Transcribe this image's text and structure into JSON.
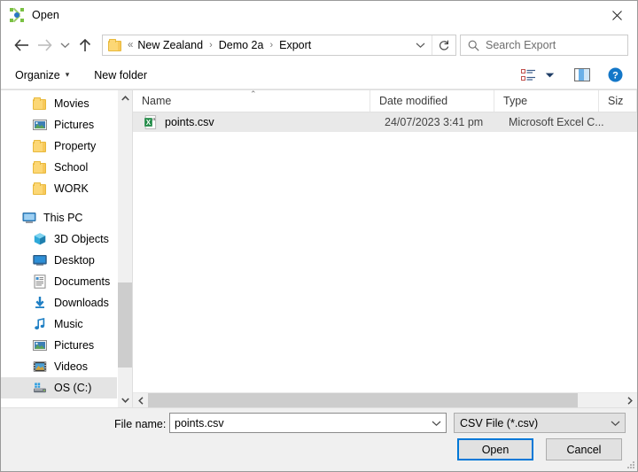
{
  "window": {
    "title": "Open",
    "app_icon": "molecule-icon",
    "close_label": "Close"
  },
  "navbar": {
    "back_icon": "back-arrow-icon",
    "forward_icon": "forward-arrow-icon",
    "recent_icon": "recent-locations-chevron-icon",
    "up_icon": "up-arrow-icon",
    "breadcrumb_lead": "«",
    "breadcrumbs": [
      "New Zealand",
      "Demo 2a",
      "Export"
    ],
    "separator": "›",
    "dropdown_icon": "chevron-down-icon",
    "refresh_icon": "refresh-icon",
    "search_icon": "search-icon",
    "search_placeholder": "Search Export",
    "search_value": ""
  },
  "commandbar": {
    "organize_label": "Organize",
    "organize_caret": "▾",
    "new_folder_label": "New folder",
    "view_icon": "list-view-icon",
    "view_caret_icon": "chevron-down-icon",
    "preview_pane_icon": "preview-pane-icon",
    "help_icon": "help-icon",
    "help_glyph": "?"
  },
  "sidebar": {
    "items": [
      {
        "label": "Movies",
        "icon": "folder-icon",
        "indent": 1,
        "selected": false
      },
      {
        "label": "Pictures",
        "icon": "pictures-icon",
        "indent": 1,
        "selected": false
      },
      {
        "label": "Property",
        "icon": "folder-icon",
        "indent": 1,
        "selected": false
      },
      {
        "label": "School",
        "icon": "folder-icon",
        "indent": 1,
        "selected": false
      },
      {
        "label": "WORK",
        "icon": "folder-icon",
        "indent": 1,
        "selected": false
      },
      {
        "label": "",
        "icon": "spacer",
        "indent": 0,
        "selected": false
      },
      {
        "label": "This PC",
        "icon": "this-pc-icon",
        "indent": 0,
        "selected": false
      },
      {
        "label": "3D Objects",
        "icon": "3d-objects-icon",
        "indent": 1,
        "selected": false
      },
      {
        "label": "Desktop",
        "icon": "desktop-icon",
        "indent": 1,
        "selected": false
      },
      {
        "label": "Documents",
        "icon": "documents-icon",
        "indent": 1,
        "selected": false
      },
      {
        "label": "Downloads",
        "icon": "downloads-icon",
        "indent": 1,
        "selected": false
      },
      {
        "label": "Music",
        "icon": "music-icon",
        "indent": 1,
        "selected": false
      },
      {
        "label": "Pictures",
        "icon": "pictures-icon",
        "indent": 1,
        "selected": false
      },
      {
        "label": "Videos",
        "icon": "videos-icon",
        "indent": 1,
        "selected": false
      },
      {
        "label": "OS (C:)",
        "icon": "drive-icon",
        "indent": 1,
        "selected": true
      }
    ],
    "scroll_up_icon": "chevron-up-icon",
    "scroll_down_icon": "chevron-down-icon"
  },
  "filelist": {
    "columns": [
      {
        "key": "name",
        "label": "Name",
        "sorted": true,
        "sort_glyph": "⌃"
      },
      {
        "key": "date",
        "label": "Date modified",
        "sorted": false
      },
      {
        "key": "type",
        "label": "Type",
        "sorted": false
      },
      {
        "key": "size",
        "label": "Siz",
        "sorted": false
      }
    ],
    "rows": [
      {
        "icon": "csv-file-icon",
        "name": "points.csv",
        "date": "24/07/2023 3:41 pm",
        "type": "Microsoft Excel C...",
        "size": "",
        "selected": true
      }
    ],
    "hscroll_left_icon": "chevron-left-icon",
    "hscroll_right_icon": "chevron-right-icon"
  },
  "footer": {
    "filename_label": "File name:",
    "filename_value": "points.csv",
    "filename_placeholder": "File name",
    "filename_chevron_icon": "chevron-down-icon",
    "filetype_value": "CSV File (*.csv)",
    "filetype_chevron_icon": "chevron-down-icon",
    "open_label": "Open",
    "cancel_label": "Cancel"
  },
  "colors": {
    "accent": "#0078d7",
    "selection": "#e9e9e9",
    "sidebar_selection": "#e4e4e4",
    "folder": "#fcd775",
    "help_blue": "#1477c8",
    "excel_green": "#1f8a45"
  }
}
